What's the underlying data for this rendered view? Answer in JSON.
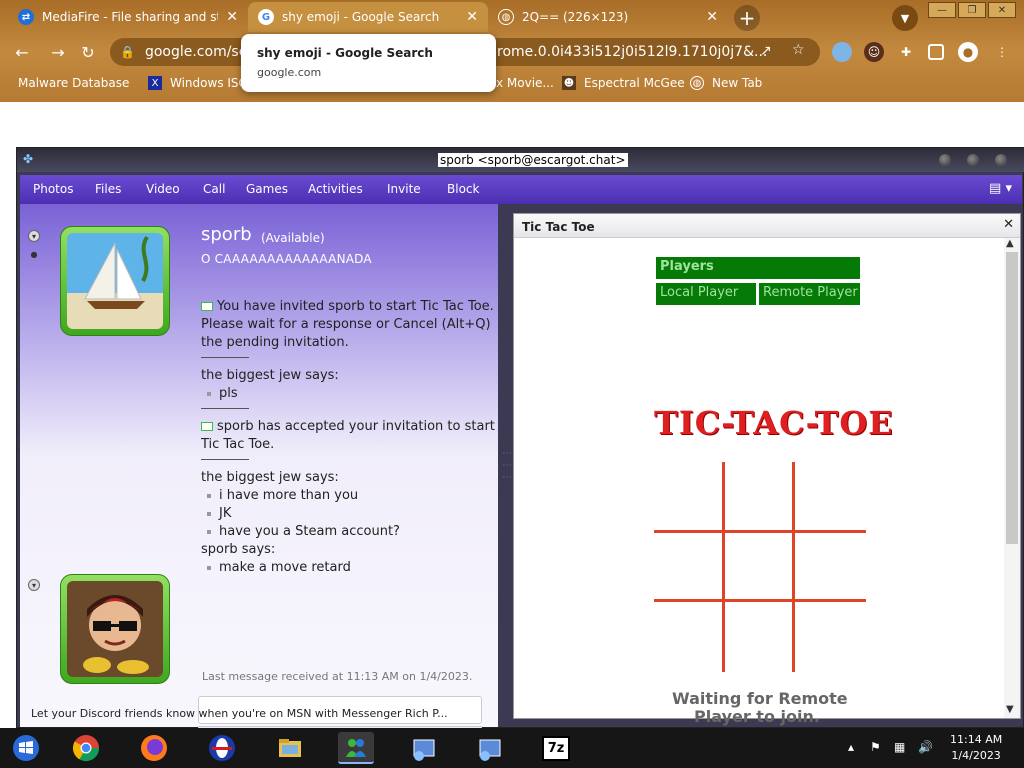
{
  "browser": {
    "tabs": [
      {
        "title": "MediaFire - File sharing and storage",
        "favicon": "mediafire-icon",
        "active": false
      },
      {
        "title": "shy emoji - Google Search",
        "favicon": "google-icon",
        "active": true
      },
      {
        "title": "2Q== (226×123)",
        "favicon": "globe-icon",
        "active": false
      }
    ],
    "url_start": "google.com/sea",
    "url_end": "rome.0.0i433i512j0i512l9.1710j0j7&...",
    "tooltip": {
      "title": "shy emoji - Google Search",
      "domain": "google.com"
    },
    "bookmarks": [
      {
        "label": "Malware Database",
        "icon": "bookmark-icon"
      },
      {
        "label": "Windows ISO",
        "icon": "x-logo-icon"
      },
      {
        "label": "x Movie...",
        "icon": "bookmark-icon"
      },
      {
        "label": "Espectral McGee",
        "icon": "character-icon"
      },
      {
        "label": "New Tab",
        "icon": "globe-icon"
      }
    ],
    "accent": "#b5752a"
  },
  "messenger": {
    "window_title": "sporb <sporb@escargot.chat>",
    "menu": [
      "Photos",
      "Files",
      "Video",
      "Call",
      "Games",
      "Activities",
      "Invite",
      "Block"
    ],
    "contact": {
      "name": "sporb",
      "status": "(Available)",
      "personal_message": "O CAAAAAAAAAAAAANADA"
    },
    "conversation": {
      "invite_msg": "You have invited sporb to start Tic Tac Toe. Please wait for a response or Cancel (Alt+Q) the pending invitation.",
      "sender1": "the biggest jew says:",
      "msg1": "pls",
      "accept_msg": "sporb has accepted your invitation to start Tic Tac Toe.",
      "sender2": "the biggest jew says:",
      "msg2": "i have more than you",
      "msg3": "JK",
      "msg4": "have you a Steam account?",
      "sender3": "sporb says:",
      "msg5": "make a move retard"
    },
    "last_message": "Last message received at 11:13 AM on 1/4/2023.",
    "rich_presence": "Let your Discord friends know when you're on MSN with Messenger Rich P...",
    "accent": "#5a3cc8"
  },
  "activity": {
    "title": "Tic Tac Toe",
    "players_label": "Players",
    "local_label": "Local Player",
    "remote_label": "Remote Player",
    "logo": "TIC-TAC-TOE",
    "waiting_line1": "Waiting for Remote",
    "waiting_line2": "Player to join.",
    "board_color": "#e04428",
    "button_color": "#067a06"
  },
  "taskbar": {
    "apps": [
      "start-icon",
      "chrome-icon",
      "firefox-icon",
      "opera-icon",
      "file-explorer-icon",
      "messenger-icon",
      "installer-icon",
      "installer-icon",
      "7zip-icon"
    ],
    "sevenzip_label": "7z",
    "time": "11:14 AM",
    "date": "1/4/2023"
  }
}
